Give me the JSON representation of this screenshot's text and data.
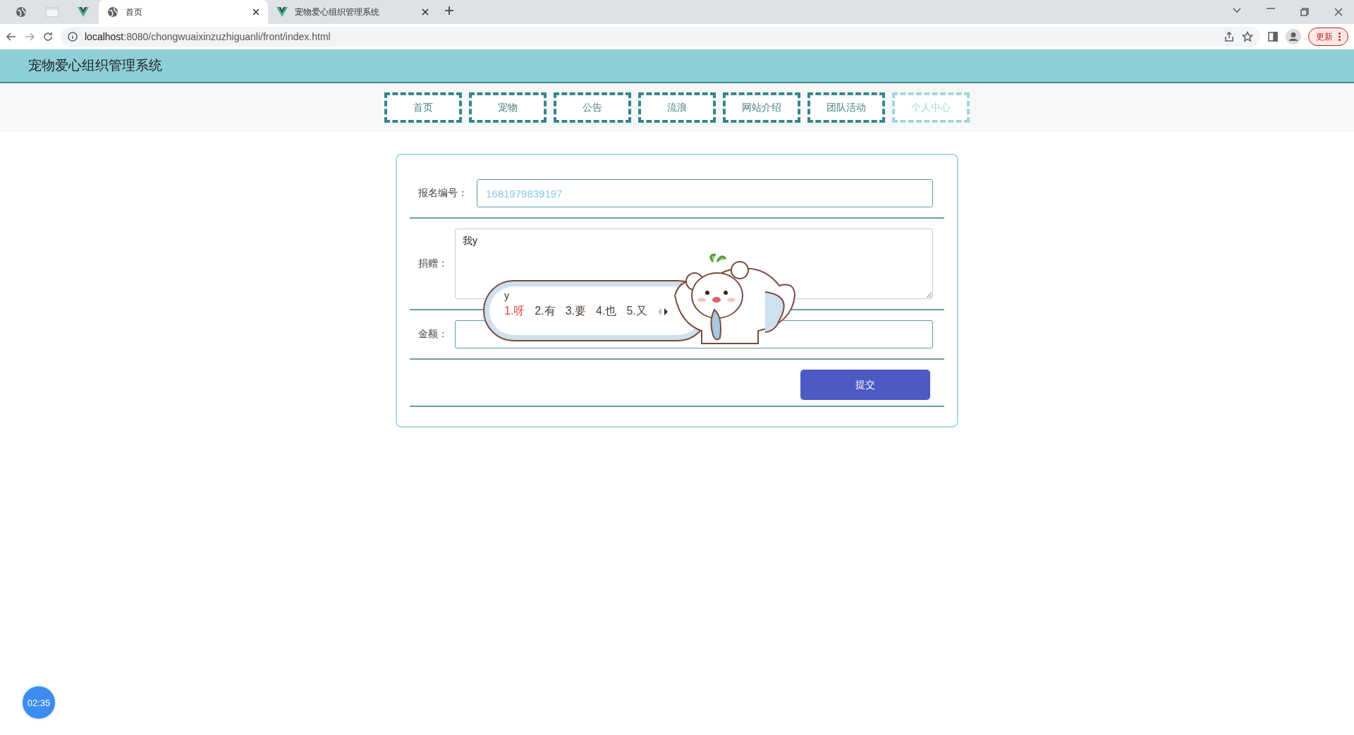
{
  "browser": {
    "tabs": [
      {
        "kind": "globe",
        "selected": false
      },
      {
        "kind": "blank",
        "selected": false
      },
      {
        "kind": "vue",
        "selected": false
      },
      {
        "kind": "globe",
        "title": "首页",
        "selected": true
      },
      {
        "kind": "vue",
        "title": "宠物爱心组织管理系统",
        "selected": false
      }
    ],
    "url_host": "localhost",
    "url_rest": ":8080/chongwuaixinzuzhiguanli/front/index.html",
    "update_button": "更新"
  },
  "app": {
    "title": "宠物爱心组织管理系统"
  },
  "nav": [
    {
      "label": "首页",
      "selected": false
    },
    {
      "label": "宠物",
      "selected": false
    },
    {
      "label": "公告",
      "selected": false
    },
    {
      "label": "流浪",
      "selected": false
    },
    {
      "label": "网站介绍",
      "selected": false
    },
    {
      "label": "团队活动",
      "selected": false
    },
    {
      "label": "个人中心",
      "selected": true
    }
  ],
  "form": {
    "fields": [
      {
        "kind": "readonly",
        "label": "报名编号：",
        "value": "1681979839197"
      },
      {
        "kind": "textarea",
        "label": "捐赠：",
        "value": "我y"
      },
      {
        "kind": "input",
        "label": "金额："
      }
    ],
    "submit": "提交"
  },
  "ime": {
    "composition": "y",
    "candidates": [
      {
        "label": "1.呀",
        "selected": true
      },
      {
        "label": "2.有",
        "selected": false
      },
      {
        "label": "3.要",
        "selected": false
      },
      {
        "label": "4.也",
        "selected": false
      },
      {
        "label": "5.又",
        "selected": false
      }
    ]
  },
  "timer": "02:35"
}
